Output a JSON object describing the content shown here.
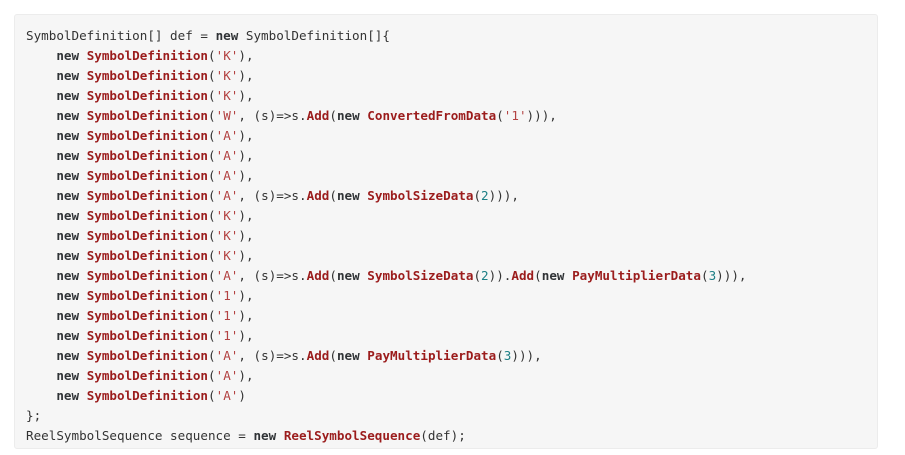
{
  "code": {
    "lines": [
      [
        {
          "t": "SymbolDefinition[] def = ",
          "k": "plain"
        },
        {
          "t": "new",
          "k": "kw"
        },
        {
          "t": " SymbolDefinition[]{",
          "k": "plain"
        }
      ],
      [
        {
          "t": "    ",
          "k": "plain"
        },
        {
          "t": "new",
          "k": "kw"
        },
        {
          "t": " ",
          "k": "plain"
        },
        {
          "t": "SymbolDefinition",
          "k": "type"
        },
        {
          "t": "(",
          "k": "plain"
        },
        {
          "t": "'K'",
          "k": "str"
        },
        {
          "t": "),",
          "k": "plain"
        }
      ],
      [
        {
          "t": "    ",
          "k": "plain"
        },
        {
          "t": "new",
          "k": "kw"
        },
        {
          "t": " ",
          "k": "plain"
        },
        {
          "t": "SymbolDefinition",
          "k": "type"
        },
        {
          "t": "(",
          "k": "plain"
        },
        {
          "t": "'K'",
          "k": "str"
        },
        {
          "t": "),",
          "k": "plain"
        }
      ],
      [
        {
          "t": "    ",
          "k": "plain"
        },
        {
          "t": "new",
          "k": "kw"
        },
        {
          "t": " ",
          "k": "plain"
        },
        {
          "t": "SymbolDefinition",
          "k": "type"
        },
        {
          "t": "(",
          "k": "plain"
        },
        {
          "t": "'K'",
          "k": "str"
        },
        {
          "t": "),",
          "k": "plain"
        }
      ],
      [
        {
          "t": "    ",
          "k": "plain"
        },
        {
          "t": "new",
          "k": "kw"
        },
        {
          "t": " ",
          "k": "plain"
        },
        {
          "t": "SymbolDefinition",
          "k": "type"
        },
        {
          "t": "(",
          "k": "plain"
        },
        {
          "t": "'W'",
          "k": "str"
        },
        {
          "t": ", (s)=>s.",
          "k": "plain"
        },
        {
          "t": "Add",
          "k": "type"
        },
        {
          "t": "(",
          "k": "plain"
        },
        {
          "t": "new",
          "k": "kw"
        },
        {
          "t": " ",
          "k": "plain"
        },
        {
          "t": "ConvertedFromData",
          "k": "type"
        },
        {
          "t": "(",
          "k": "plain"
        },
        {
          "t": "'1'",
          "k": "str"
        },
        {
          "t": "))),",
          "k": "plain"
        }
      ],
      [
        {
          "t": "    ",
          "k": "plain"
        },
        {
          "t": "new",
          "k": "kw"
        },
        {
          "t": " ",
          "k": "plain"
        },
        {
          "t": "SymbolDefinition",
          "k": "type"
        },
        {
          "t": "(",
          "k": "plain"
        },
        {
          "t": "'A'",
          "k": "str"
        },
        {
          "t": "),",
          "k": "plain"
        }
      ],
      [
        {
          "t": "    ",
          "k": "plain"
        },
        {
          "t": "new",
          "k": "kw"
        },
        {
          "t": " ",
          "k": "plain"
        },
        {
          "t": "SymbolDefinition",
          "k": "type"
        },
        {
          "t": "(",
          "k": "plain"
        },
        {
          "t": "'A'",
          "k": "str"
        },
        {
          "t": "),",
          "k": "plain"
        }
      ],
      [
        {
          "t": "    ",
          "k": "plain"
        },
        {
          "t": "new",
          "k": "kw"
        },
        {
          "t": " ",
          "k": "plain"
        },
        {
          "t": "SymbolDefinition",
          "k": "type"
        },
        {
          "t": "(",
          "k": "plain"
        },
        {
          "t": "'A'",
          "k": "str"
        },
        {
          "t": "),",
          "k": "plain"
        }
      ],
      [
        {
          "t": "    ",
          "k": "plain"
        },
        {
          "t": "new",
          "k": "kw"
        },
        {
          "t": " ",
          "k": "plain"
        },
        {
          "t": "SymbolDefinition",
          "k": "type"
        },
        {
          "t": "(",
          "k": "plain"
        },
        {
          "t": "'A'",
          "k": "str"
        },
        {
          "t": ", (s)=>s.",
          "k": "plain"
        },
        {
          "t": "Add",
          "k": "type"
        },
        {
          "t": "(",
          "k": "plain"
        },
        {
          "t": "new",
          "k": "kw"
        },
        {
          "t": " ",
          "k": "plain"
        },
        {
          "t": "SymbolSizeData",
          "k": "type"
        },
        {
          "t": "(",
          "k": "plain"
        },
        {
          "t": "2",
          "k": "num"
        },
        {
          "t": "))),",
          "k": "plain"
        }
      ],
      [
        {
          "t": "    ",
          "k": "plain"
        },
        {
          "t": "new",
          "k": "kw"
        },
        {
          "t": " ",
          "k": "plain"
        },
        {
          "t": "SymbolDefinition",
          "k": "type"
        },
        {
          "t": "(",
          "k": "plain"
        },
        {
          "t": "'K'",
          "k": "str"
        },
        {
          "t": "),",
          "k": "plain"
        }
      ],
      [
        {
          "t": "    ",
          "k": "plain"
        },
        {
          "t": "new",
          "k": "kw"
        },
        {
          "t": " ",
          "k": "plain"
        },
        {
          "t": "SymbolDefinition",
          "k": "type"
        },
        {
          "t": "(",
          "k": "plain"
        },
        {
          "t": "'K'",
          "k": "str"
        },
        {
          "t": "),",
          "k": "plain"
        }
      ],
      [
        {
          "t": "    ",
          "k": "plain"
        },
        {
          "t": "new",
          "k": "kw"
        },
        {
          "t": " ",
          "k": "plain"
        },
        {
          "t": "SymbolDefinition",
          "k": "type"
        },
        {
          "t": "(",
          "k": "plain"
        },
        {
          "t": "'K'",
          "k": "str"
        },
        {
          "t": "),",
          "k": "plain"
        }
      ],
      [
        {
          "t": "    ",
          "k": "plain"
        },
        {
          "t": "new",
          "k": "kw"
        },
        {
          "t": " ",
          "k": "plain"
        },
        {
          "t": "SymbolDefinition",
          "k": "type"
        },
        {
          "t": "(",
          "k": "plain"
        },
        {
          "t": "'A'",
          "k": "str"
        },
        {
          "t": ", (s)=>s.",
          "k": "plain"
        },
        {
          "t": "Add",
          "k": "type"
        },
        {
          "t": "(",
          "k": "plain"
        },
        {
          "t": "new",
          "k": "kw"
        },
        {
          "t": " ",
          "k": "plain"
        },
        {
          "t": "SymbolSizeData",
          "k": "type"
        },
        {
          "t": "(",
          "k": "plain"
        },
        {
          "t": "2",
          "k": "num"
        },
        {
          "t": ")).",
          "k": "plain"
        },
        {
          "t": "Add",
          "k": "type"
        },
        {
          "t": "(",
          "k": "plain"
        },
        {
          "t": "new",
          "k": "kw"
        },
        {
          "t": " ",
          "k": "plain"
        },
        {
          "t": "PayMultiplierData",
          "k": "type"
        },
        {
          "t": "(",
          "k": "plain"
        },
        {
          "t": "3",
          "k": "num"
        },
        {
          "t": "))),",
          "k": "plain"
        }
      ],
      [
        {
          "t": "    ",
          "k": "plain"
        },
        {
          "t": "new",
          "k": "kw"
        },
        {
          "t": " ",
          "k": "plain"
        },
        {
          "t": "SymbolDefinition",
          "k": "type"
        },
        {
          "t": "(",
          "k": "plain"
        },
        {
          "t": "'1'",
          "k": "str"
        },
        {
          "t": "),",
          "k": "plain"
        }
      ],
      [
        {
          "t": "    ",
          "k": "plain"
        },
        {
          "t": "new",
          "k": "kw"
        },
        {
          "t": " ",
          "k": "plain"
        },
        {
          "t": "SymbolDefinition",
          "k": "type"
        },
        {
          "t": "(",
          "k": "plain"
        },
        {
          "t": "'1'",
          "k": "str"
        },
        {
          "t": "),",
          "k": "plain"
        }
      ],
      [
        {
          "t": "    ",
          "k": "plain"
        },
        {
          "t": "new",
          "k": "kw"
        },
        {
          "t": " ",
          "k": "plain"
        },
        {
          "t": "SymbolDefinition",
          "k": "type"
        },
        {
          "t": "(",
          "k": "plain"
        },
        {
          "t": "'1'",
          "k": "str"
        },
        {
          "t": "),",
          "k": "plain"
        }
      ],
      [
        {
          "t": "    ",
          "k": "plain"
        },
        {
          "t": "new",
          "k": "kw"
        },
        {
          "t": " ",
          "k": "plain"
        },
        {
          "t": "SymbolDefinition",
          "k": "type"
        },
        {
          "t": "(",
          "k": "plain"
        },
        {
          "t": "'A'",
          "k": "str"
        },
        {
          "t": ", (s)=>s.",
          "k": "plain"
        },
        {
          "t": "Add",
          "k": "type"
        },
        {
          "t": "(",
          "k": "plain"
        },
        {
          "t": "new",
          "k": "kw"
        },
        {
          "t": " ",
          "k": "plain"
        },
        {
          "t": "PayMultiplierData",
          "k": "type"
        },
        {
          "t": "(",
          "k": "plain"
        },
        {
          "t": "3",
          "k": "num"
        },
        {
          "t": "))),",
          "k": "plain"
        }
      ],
      [
        {
          "t": "    ",
          "k": "plain"
        },
        {
          "t": "new",
          "k": "kw"
        },
        {
          "t": " ",
          "k": "plain"
        },
        {
          "t": "SymbolDefinition",
          "k": "type"
        },
        {
          "t": "(",
          "k": "plain"
        },
        {
          "t": "'A'",
          "k": "str"
        },
        {
          "t": "),",
          "k": "plain"
        }
      ],
      [
        {
          "t": "    ",
          "k": "plain"
        },
        {
          "t": "new",
          "k": "kw"
        },
        {
          "t": " ",
          "k": "plain"
        },
        {
          "t": "SymbolDefinition",
          "k": "type"
        },
        {
          "t": "(",
          "k": "plain"
        },
        {
          "t": "'A'",
          "k": "str"
        },
        {
          "t": ")",
          "k": "plain"
        }
      ],
      [
        {
          "t": "};",
          "k": "plain"
        }
      ],
      [
        {
          "t": "ReelSymbolSequence sequence = ",
          "k": "plain"
        },
        {
          "t": "new",
          "k": "kw"
        },
        {
          "t": " ",
          "k": "plain"
        },
        {
          "t": "ReelSymbolSequence",
          "k": "type"
        },
        {
          "t": "(def);",
          "k": "plain"
        }
      ]
    ]
  },
  "colors": {
    "background": "#f6f6f6",
    "keyword": "#303336",
    "type": "#9b1c1c",
    "string": "#b34242",
    "number": "#1e7f86",
    "plain": "#333333"
  }
}
